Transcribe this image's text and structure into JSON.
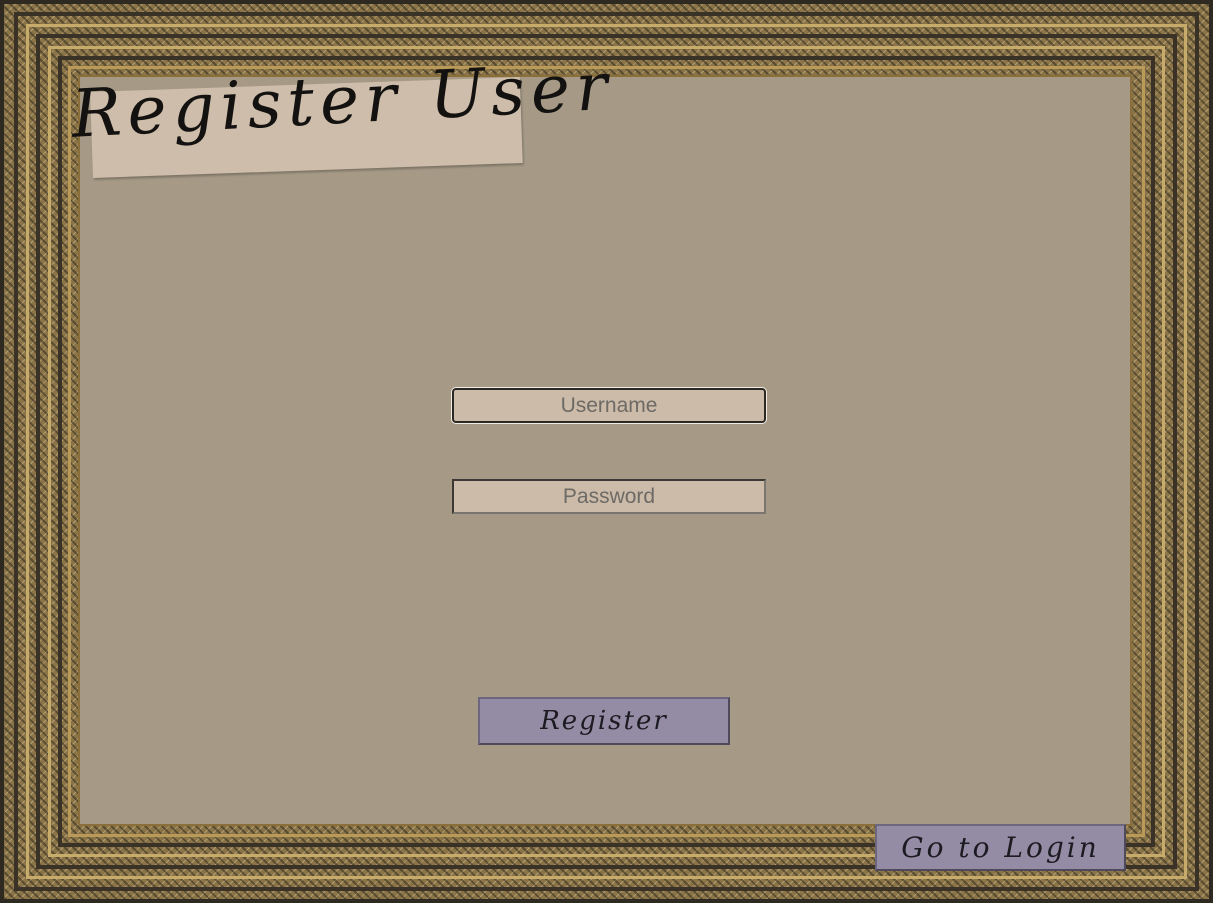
{
  "page": {
    "title": "Register User"
  },
  "form": {
    "username": {
      "value": "",
      "placeholder": "Username"
    },
    "password": {
      "value": "",
      "placeholder": "Password"
    },
    "register_label": "Register"
  },
  "nav": {
    "login_label": "Go to Login"
  },
  "colors": {
    "canvas_background": "#a69a87",
    "paper": "#cdbdaa",
    "button": "#948ca5",
    "frame_gold": "#c7ab6b",
    "frame_dark": "#3a3226"
  }
}
